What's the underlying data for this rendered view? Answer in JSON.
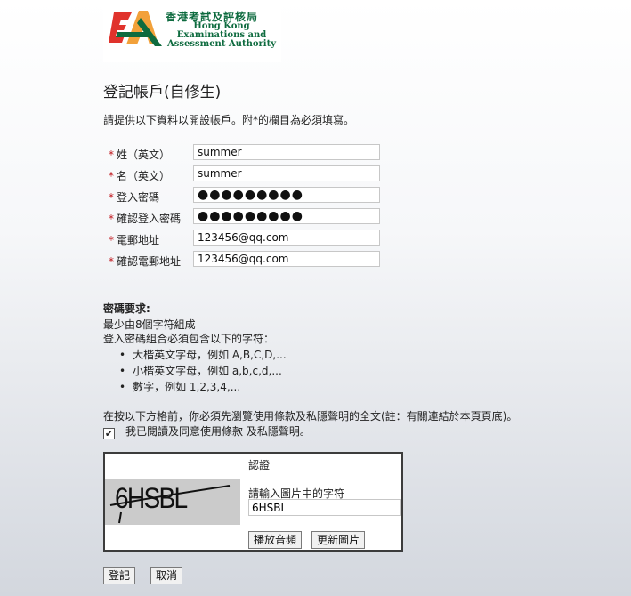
{
  "logo": {
    "name_zh": "香港考試及評核局",
    "name_en_1": "Hong Kong",
    "name_en_2": "Examinations and",
    "name_en_3": "Assessment Authority",
    "colors": {
      "red": "#e0332c",
      "orange": "#f2a13a",
      "green": "#0e6b3f"
    }
  },
  "page": {
    "title": "登記帳戶(自修生)",
    "intro": "請提供以下資料以開設帳戶。附*的欄目為必須填寫。"
  },
  "form": {
    "required_mark": "*",
    "fields": [
      {
        "label": "姓（英文）",
        "value": "summer"
      },
      {
        "label": "名（英文）",
        "value": "summer"
      },
      {
        "label": "登入密碼",
        "value": "●●●●●●●●●"
      },
      {
        "label": "確認登入密碼",
        "value": "●●●●●●●●●"
      },
      {
        "label": "電郵地址",
        "value": "123456@qq.com"
      },
      {
        "label": "確認電郵地址",
        "value": "123456@qq.com"
      }
    ]
  },
  "password_rules": {
    "title": "密碼要求:",
    "line1": "最少由8個字符組成",
    "line2": "登入密碼組合必須包含以下的字符：",
    "items": [
      "大楷英文字母，例如 A,B,C,D,...",
      "小楷英文字母，例如 a,b,c,d,...",
      "數字，例如 1,2,3,4,..."
    ]
  },
  "terms": {
    "notice": "在按以下方格前，你必須先瀏覽使用條款及私隱聲明的全文(註：有關連結於本頁頁底)。",
    "agree_label": "我已閱讀及同意使用條款 及私隱聲明。",
    "checked_glyph": "✔"
  },
  "captcha": {
    "title": "認證",
    "image_text": "6HSBL",
    "prompt": "請輸入圖片中的字符",
    "value": "6HSBL",
    "audio_button": "播放音頻",
    "refresh_button": "更新圖片"
  },
  "actions": {
    "submit": "登記",
    "cancel": "取消"
  }
}
